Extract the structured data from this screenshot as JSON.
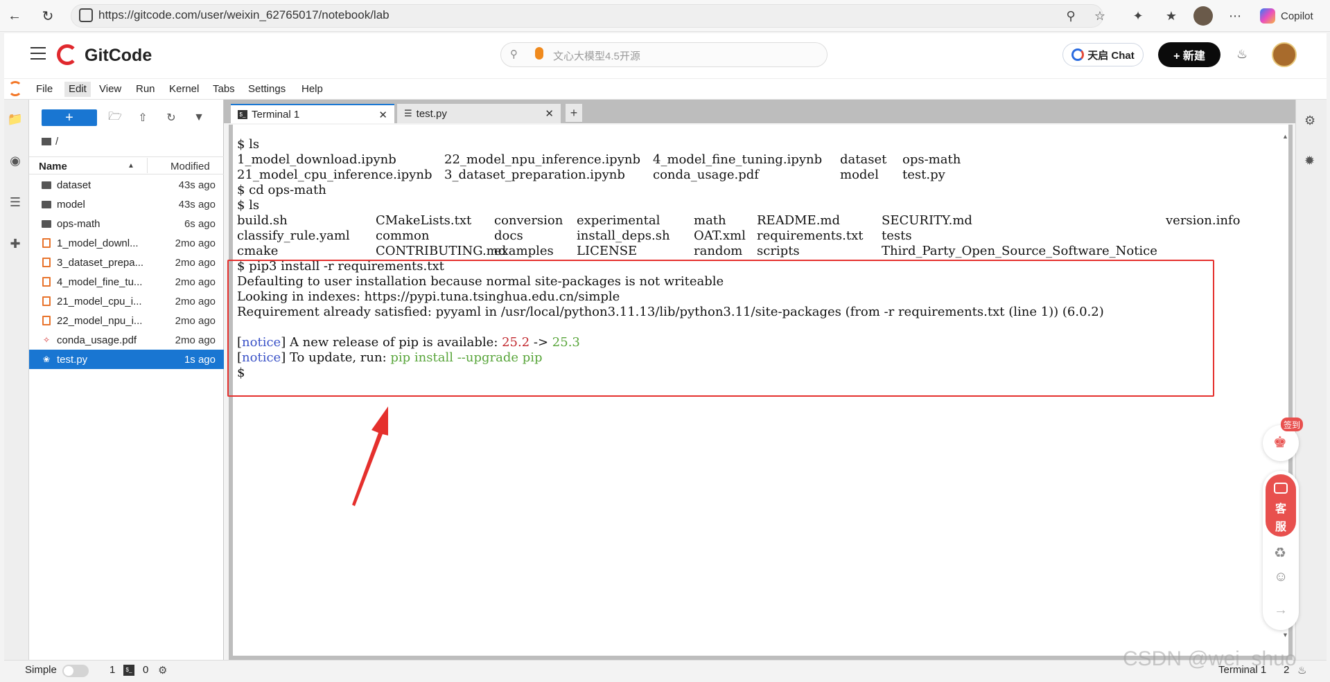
{
  "browser": {
    "url": "https://gitcode.com/user/weixin_62765017/notebook/lab",
    "copilot_label": "Copilot"
  },
  "header": {
    "brand": "GitCode",
    "search_placeholder": "文心大模型4.5开源",
    "chat_label": "天启 Chat",
    "new_label": "+ 新建"
  },
  "menu": [
    "File",
    "Edit",
    "View",
    "Run",
    "Kernel",
    "Tabs",
    "Settings",
    "Help"
  ],
  "filebrowser": {
    "breadcrumb": "/",
    "col_name": "Name",
    "col_modified": "Modified",
    "files": [
      {
        "name": "dataset",
        "modified": "43s ago",
        "icon": "folder-icon"
      },
      {
        "name": "model",
        "modified": "43s ago",
        "icon": "folder-icon"
      },
      {
        "name": "ops-math",
        "modified": "6s ago",
        "icon": "folder-icon"
      },
      {
        "name": "1_model_downl...",
        "modified": "2mo ago",
        "icon": "notebook-icon"
      },
      {
        "name": "3_dataset_prepa...",
        "modified": "2mo ago",
        "icon": "notebook-icon"
      },
      {
        "name": "4_model_fine_tu...",
        "modified": "2mo ago",
        "icon": "notebook-icon"
      },
      {
        "name": "21_model_cpu_i...",
        "modified": "2mo ago",
        "icon": "notebook-icon"
      },
      {
        "name": "22_model_npu_i...",
        "modified": "2mo ago",
        "icon": "notebook-icon"
      },
      {
        "name": "conda_usage.pdf",
        "modified": "2mo ago",
        "icon": "pdf-icon"
      },
      {
        "name": "test.py",
        "modified": "1s ago",
        "icon": "python-icon"
      }
    ]
  },
  "tabs": [
    {
      "label": "Terminal 1",
      "active": true
    },
    {
      "label": "test.py",
      "active": false
    }
  ],
  "terminal": {
    "l1": "$ ls",
    "ls1": [
      [
        "1_model_download.ipynb",
        "22_model_npu_inference.ipynb",
        "4_model_fine_tuning.ipynb",
        "dataset",
        "ops-math"
      ],
      [
        "21_model_cpu_inference.ipynb",
        "3_dataset_preparation.ipynb",
        "conda_usage.pdf",
        "model",
        "test.py"
      ]
    ],
    "l4": "$ cd ops-math",
    "l5": "$ ls",
    "ls2": [
      [
        "build.sh",
        "CMakeLists.txt",
        "conversion",
        "experimental",
        "math",
        "README.md",
        "SECURITY.md",
        "version.info"
      ],
      [
        "classify_rule.yaml",
        "common",
        "docs",
        "install_deps.sh",
        "OAT.xml",
        "requirements.txt",
        "tests",
        ""
      ],
      [
        "cmake",
        "CONTRIBUTING.md",
        "examples",
        "LICENSE",
        "random",
        "scripts",
        "Third_Party_Open_Source_Software_Notice",
        ""
      ]
    ],
    "pip_cmd": "$ pip3 install -r requirements.txt",
    "pip_1": "Defaulting to user installation because normal site-packages is not writeable",
    "pip_2": "Looking in indexes: https://pypi.tuna.tsinghua.edu.cn/simple",
    "pip_3": "Requirement already satisfied: pyyaml in /usr/local/python3.11.13/lib/python3.11/site-packages (from -r requirements.txt (line 1)) (6.0.2)",
    "notice_tag": "notice",
    "notice1_text": " A new release of pip is available: ",
    "old_ver": "25.2",
    "arrow": " -> ",
    "new_ver": "25.3",
    "notice2_text": " To update, run: ",
    "upgrade_cmd": "pip install --upgrade pip",
    "prompt": "$"
  },
  "side_float": {
    "checkin": "签到",
    "kefu_1": "客",
    "kefu_2": "服"
  },
  "status": {
    "mode": "Simple",
    "count1": "1",
    "count2": "0",
    "right_label": "Terminal 1",
    "right_num": "2"
  },
  "watermark": "CSDN @wei_shuo",
  "colors": {
    "accent": "#1976d2",
    "highlight": "#e5302d",
    "brand_red": "#e8504e"
  }
}
